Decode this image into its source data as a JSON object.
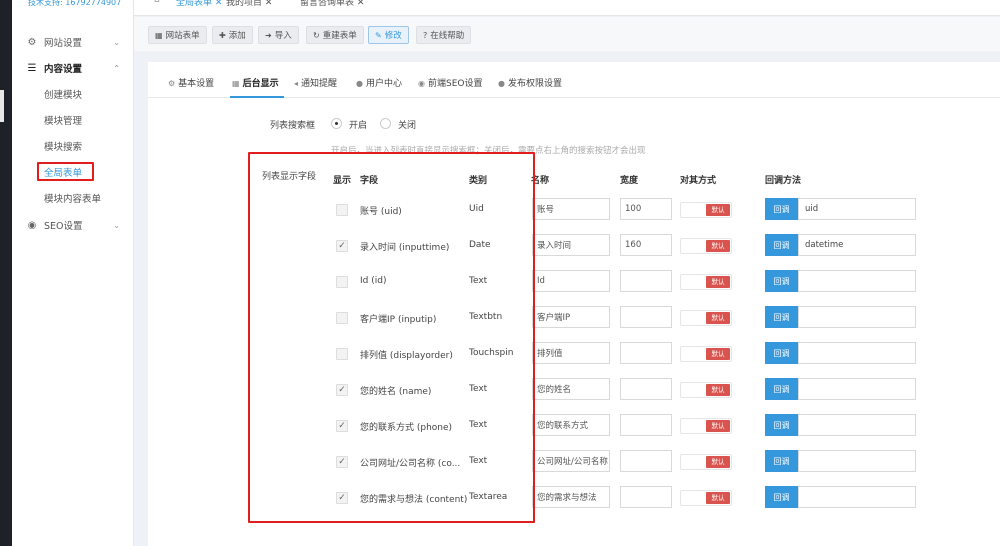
{
  "support_text": "技术支持: 16792774907",
  "top_tabs": [
    {
      "label": "全局表单 ✕",
      "active": true
    },
    {
      "label": "我的项目 ✕",
      "active": false
    },
    {
      "label": "留言咨询单表 ✕",
      "active": false
    }
  ],
  "sidebar": {
    "groups": [
      {
        "label": "网站设置",
        "icon": "gear-icon",
        "expanded": false
      },
      {
        "label": "内容设置",
        "icon": "menu-icon",
        "expanded": true
      },
      {
        "label": "SEO设置",
        "icon": "globe-icon",
        "expanded": false
      }
    ],
    "sub_items": [
      "创建模块",
      "模块管理",
      "模块搜索",
      "全局表单",
      "模块内容表单"
    ],
    "current_sub": "全局表单"
  },
  "toolbar": {
    "buttons": [
      {
        "label": "网站表单",
        "icon": "table-icon"
      },
      {
        "label": "添加",
        "icon": "plus-icon"
      },
      {
        "label": "导入",
        "icon": "import-icon"
      },
      {
        "label": "重建表单",
        "icon": "refresh-icon"
      },
      {
        "label": "修改",
        "icon": "edit-icon"
      },
      {
        "label": "在线帮助",
        "icon": "help-icon"
      }
    ]
  },
  "panel_tabs": [
    {
      "label": "基本设置",
      "icon": "gear-icon"
    },
    {
      "label": "后台显示",
      "icon": "table-icon"
    },
    {
      "label": "通知提醒",
      "icon": "volume-icon"
    },
    {
      "label": "用户中心",
      "icon": "user-icon"
    },
    {
      "label": "前端SEO设置",
      "icon": "globe-icon"
    },
    {
      "label": "发布权限设置",
      "icon": "user-icon"
    }
  ],
  "search_box": {
    "label": "列表搜索框",
    "on_label": "开启",
    "off_label": "关闭",
    "selected": "开启",
    "help": "开启后，当进入列表时直接显示搜索框；关闭后，需要点右上角的搜索按钮才会出现"
  },
  "fields_section": {
    "label": "列表显示字段",
    "headers": {
      "show": "显示",
      "field": "字段",
      "type": "类别",
      "name": "名称",
      "width": "宽度",
      "align": "对其方式",
      "callback": "回调方法"
    },
    "default_label": "默认",
    "callback_label": "回调",
    "rows": [
      {
        "show": false,
        "field": "账号 (uid)",
        "type": "Uid",
        "name": "账号",
        "width": "100",
        "callback": "uid"
      },
      {
        "show": true,
        "field": "录入时间 (inputtime)",
        "type": "Date",
        "name": "录入时间",
        "width": "160",
        "callback": "datetime"
      },
      {
        "show": false,
        "field": "Id (id)",
        "type": "Text",
        "name": "Id",
        "width": "",
        "callback": ""
      },
      {
        "show": false,
        "field": "客户端IP (inputip)",
        "type": "Textbtn",
        "name": "客户端IP",
        "width": "",
        "callback": ""
      },
      {
        "show": false,
        "field": "排列值 (displayorder)",
        "type": "Touchspin",
        "name": "排列值",
        "width": "",
        "callback": ""
      },
      {
        "show": true,
        "field": "您的姓名 (name)",
        "type": "Text",
        "name": "您的姓名",
        "width": "",
        "callback": ""
      },
      {
        "show": true,
        "field": "您的联系方式 (phone)",
        "type": "Text",
        "name": "您的联系方式",
        "width": "",
        "callback": ""
      },
      {
        "show": true,
        "field": "公司网址/公司名称 (co...",
        "type": "Text",
        "name": "公司网址/公司名称",
        "width": "",
        "callback": ""
      },
      {
        "show": true,
        "field": "您的需求与想法 (content)",
        "type": "Textarea",
        "name": "您的需求与想法",
        "width": "",
        "callback": ""
      }
    ]
  },
  "colors": {
    "accent": "#3598dc",
    "danger": "#d9534f",
    "highlight": "#e21d1d"
  }
}
